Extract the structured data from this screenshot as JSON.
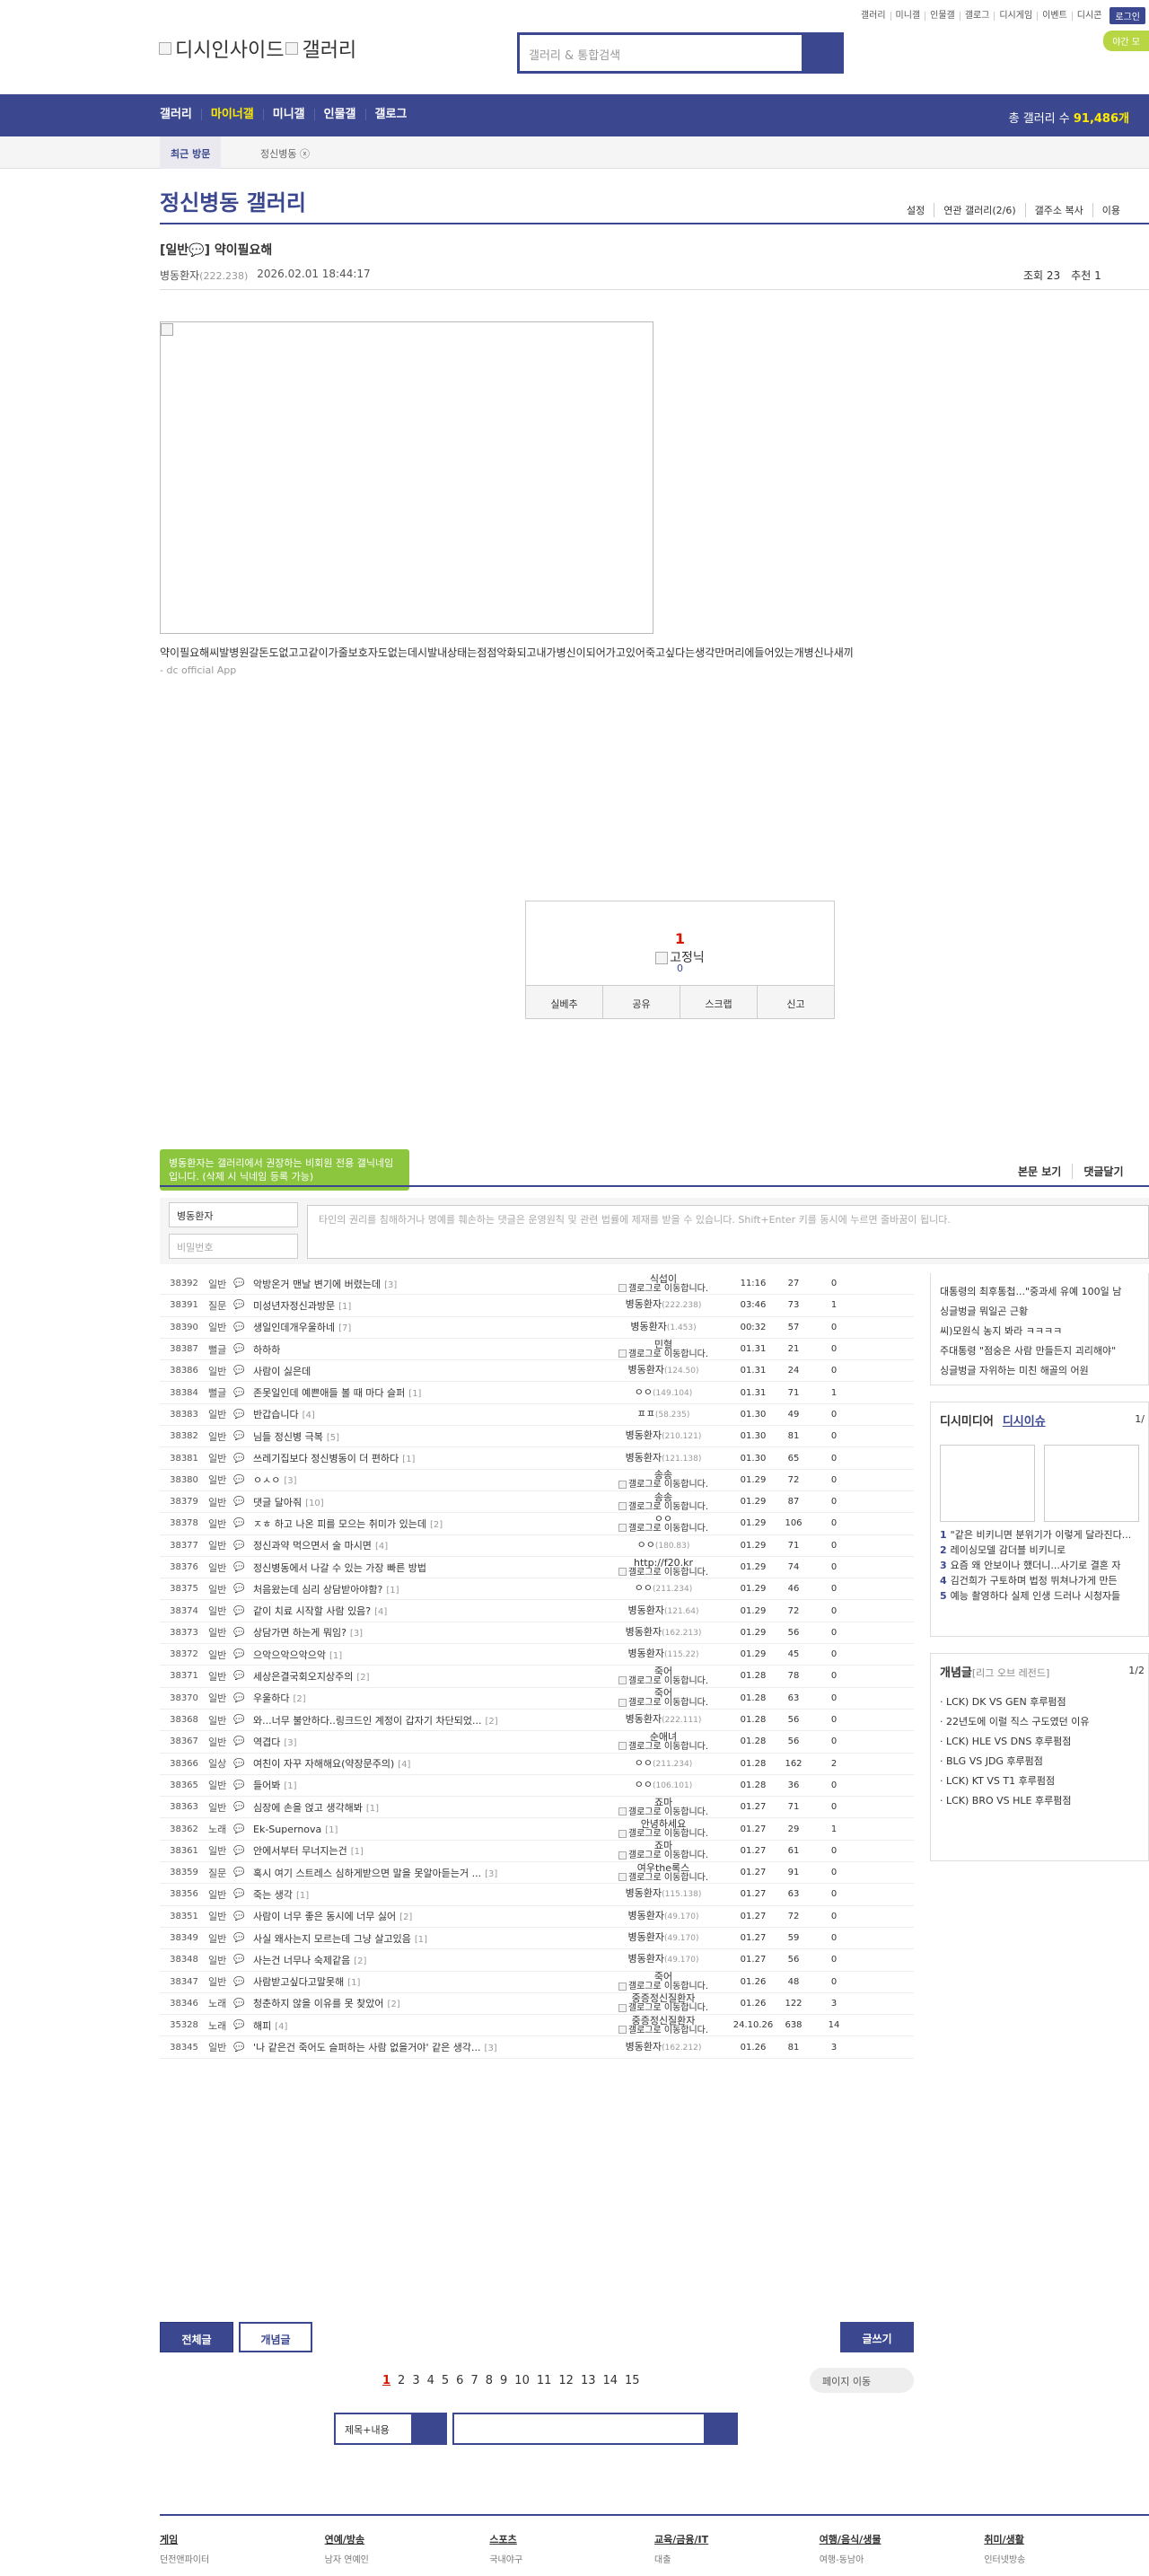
{
  "util": {
    "items": [
      "갤러리",
      "미니갤",
      "인물갤",
      "갤로그",
      "디시게임",
      "이벤트",
      "디시콘"
    ],
    "login": "로그인",
    "app": "야간 모"
  },
  "logo": {
    "alt1": "디시인사이드",
    "alt2": "갤러리"
  },
  "search": {
    "placeholder": "갤러리 & 통합검색"
  },
  "gnb": {
    "items": [
      "갤러리",
      "마이너갤",
      "미니갤",
      "인물갤",
      "갤로그"
    ],
    "count_label": "총 갤러리 수",
    "count_value": "91,486개"
  },
  "recent": {
    "tab": "최근 방문",
    "item": "정신병동"
  },
  "gallery": {
    "title": "정신병동 갤러리",
    "menu": [
      "설정",
      "연관 갤러리(2/6)",
      "갤주소 복사",
      "이용"
    ]
  },
  "post": {
    "title": "[일반💬] 약이필요해",
    "writer": "병동환자",
    "ip": "(222.238)",
    "date": "2026.02.01 18:44:17",
    "views": "조회 23",
    "recommends": "추천 1",
    "body": "약이필요해씨발병원갈돈도없고고같이가줄보호자도없는데시발내상태는점점악화되고내가병신이되어가고있어죽고싶다는생각만머리에들어있는개병신나새끼",
    "body_display": "약이필요해씨발병원갈돈도없고고같이가줄보호자도없는데시발내상태는점점악화되고내가병신이되어가고있어죽고싶다는생각만머리에들어있는개병신나새끼",
    "sub": "- dc official App"
  },
  "vote": {
    "count": "1",
    "image_alt": "고정닉",
    "fixed_count": "0",
    "buttons": [
      "실베추",
      "공유",
      "스크랩",
      "신고"
    ]
  },
  "comment": {
    "tooltip": "병동환자는 갤러리에서 권장하는 비회원 전용 갤닉네임입니다. (삭제 시 닉네임 등록 가능)",
    "links": [
      "본문 보기",
      "댓글달기"
    ],
    "name_value": "병동환자",
    "pw_placeholder": "비밀번호",
    "area_placeholder": "타인의 권리를 침해하거나 명예를 훼손하는 댓글은 운영원칙 및 관련 법률에 제재를 받을 수 있습니다. Shift+Enter 키를 동시에 누르면 줄바꿈이 됩니다."
  },
  "posts": [
    {
      "no": "38392",
      "sub": "일반",
      "title": "악방온거 맨날 변기에 버렸는데",
      "rc": "[3]",
      "writer": "식섭이",
      "gal": "갤로그로 이동합니다.",
      "date": "11:16",
      "view": "27",
      "rec": "0"
    },
    {
      "no": "38391",
      "sub": "질문",
      "title": "미성년자정신과방문",
      "rc": "[1]",
      "writer": "병동환자",
      "ip": "(222.238)",
      "date": "03:46",
      "view": "73",
      "rec": "1"
    },
    {
      "no": "38390",
      "sub": "일반",
      "title": "생일인데개우울하네",
      "rc": "[7]",
      "writer": "병동환자",
      "ip": "(1.453)",
      "date": "00:32",
      "view": "57",
      "rec": "0"
    },
    {
      "no": "38387",
      "sub": "뻘글",
      "title": "하하하",
      "rc": "",
      "writer": "민혈",
      "gal": "갤로그로 이동합니다.",
      "date": "01.31",
      "view": "21",
      "rec": "0"
    },
    {
      "no": "38386",
      "sub": "일반",
      "title": "사람이 싫은데",
      "rc": "",
      "writer": "병동환자",
      "ip": "(124.50)",
      "date": "01.31",
      "view": "24",
      "rec": "0"
    },
    {
      "no": "38384",
      "sub": "뻘글",
      "title": "존못일인데 예쁜애들 볼 때 마다 슬퍼",
      "rc": "[1]",
      "writer": "ㅇㅇ",
      "ip": "(149.104)",
      "date": "01.31",
      "view": "71",
      "rec": "1"
    },
    {
      "no": "38383",
      "sub": "일반",
      "title": "반갑습니다",
      "rc": "[4]",
      "writer": "ㅍㅍ",
      "ip": "(58.235)",
      "date": "01.30",
      "view": "49",
      "rec": "0"
    },
    {
      "no": "38382",
      "sub": "일반",
      "title": "님들 정신병 극복",
      "rc": "[5]",
      "writer": "병동환자",
      "ip": "(210.121)",
      "date": "01.30",
      "view": "81",
      "rec": "0"
    },
    {
      "no": "38381",
      "sub": "일반",
      "title": "쓰레기집보다 정신병동이 더 편하다",
      "rc": "[1]",
      "writer": "병동환자",
      "ip": "(121.138)",
      "date": "01.30",
      "view": "65",
      "rec": "0"
    },
    {
      "no": "38380",
      "sub": "일반",
      "title": "ㅇㅅㅇ",
      "rc": "[3]",
      "writer": "송송",
      "gal": "갤로그로 이동합니다.",
      "date": "01.29",
      "view": "72",
      "rec": "0"
    },
    {
      "no": "38379",
      "sub": "일반",
      "title": "댓글 달아줘",
      "rc": "[10]",
      "writer": "송송",
      "gal": "갤로그로 이동합니다.",
      "date": "01.29",
      "view": "87",
      "rec": "0"
    },
    {
      "no": "38378",
      "sub": "일반",
      "title": "ㅈㅎ 하고 나온 피를 모으는 취미가 있는데",
      "rc": "[2]",
      "writer": "ㅇㅇ",
      "gal": "갤로그로 이동합니다.",
      "date": "01.29",
      "view": "106",
      "rec": "0"
    },
    {
      "no": "38377",
      "sub": "일반",
      "title": "정신과약 먹으면서 술 마시면",
      "rc": "[4]",
      "writer": "ㅇㅇ",
      "ip": "(180.83)",
      "date": "01.29",
      "view": "71",
      "rec": "0"
    },
    {
      "no": "38376",
      "sub": "일반",
      "title": "정신병동에서 나갈 수 있는 가장 빠른 방법",
      "rc": "",
      "writer": "http://f20.kr",
      "gal": "갤로그로 이동합니다.",
      "date": "01.29",
      "view": "74",
      "rec": "0"
    },
    {
      "no": "38375",
      "sub": "일반",
      "title": "처음왔는데 심리 상담받아야함?",
      "rc": "[1]",
      "writer": "ㅇㅇ",
      "ip": "(211.234)",
      "date": "01.29",
      "view": "46",
      "rec": "0"
    },
    {
      "no": "38374",
      "sub": "일반",
      "title": "같이 치료 시작할 사람 있음?",
      "rc": "[4]",
      "writer": "병동환자",
      "ip": "(121.64)",
      "date": "01.29",
      "view": "72",
      "rec": "0"
    },
    {
      "no": "38373",
      "sub": "일반",
      "title": "상담가면 하는게 뭐임?",
      "rc": "[3]",
      "writer": "병동환자",
      "ip": "(162.213)",
      "date": "01.29",
      "view": "56",
      "rec": "0"
    },
    {
      "no": "38372",
      "sub": "일반",
      "title": "으악으악으악으악",
      "rc": "[1]",
      "writer": "병동환자",
      "ip": "(115.22)",
      "date": "01.29",
      "view": "45",
      "rec": "0"
    },
    {
      "no": "38371",
      "sub": "일반",
      "title": "세상은결국회오지상주의",
      "rc": "[2]",
      "writer": "죽어",
      "gal": "갤로그로 이동합니다.",
      "date": "01.28",
      "view": "78",
      "rec": "0"
    },
    {
      "no": "38370",
      "sub": "일반",
      "title": "우울하다",
      "rc": "[2]",
      "writer": "죽어",
      "gal": "갤로그로 이동합니다.",
      "date": "01.28",
      "view": "63",
      "rec": "0"
    },
    {
      "no": "38368",
      "sub": "일반",
      "title": "와...너무 불안하다..링크드인 계정이 갑자기 차단되었...",
      "rc": "[2]",
      "writer": "병동환자",
      "ip": "(222.111)",
      "date": "01.28",
      "view": "56",
      "rec": "0"
    },
    {
      "no": "38367",
      "sub": "일반",
      "title": "역겹다",
      "rc": "[3]",
      "writer": "순애녀",
      "gal": "갤로그로 이동합니다.",
      "date": "01.28",
      "view": "56",
      "rec": "0"
    },
    {
      "no": "38366",
      "sub": "일상",
      "title": "여친이 자꾸 자해해요(약장문주의)",
      "rc": "[4]",
      "writer": "ㅇㅇ",
      "ip": "(211.234)",
      "date": "01.28",
      "view": "162",
      "rec": "2"
    },
    {
      "no": "38365",
      "sub": "일반",
      "title": "들어봐",
      "rc": "[1]",
      "writer": "ㅇㅇ",
      "ip": "(106.101)",
      "date": "01.28",
      "view": "36",
      "rec": "0"
    },
    {
      "no": "38363",
      "sub": "일반",
      "title": "심장에 손을 얹고 생각해봐",
      "rc": "[1]",
      "writer": "죠마",
      "gal": "갤로그로 이동합니다.",
      "date": "01.27",
      "view": "71",
      "rec": "0"
    },
    {
      "no": "38362",
      "sub": "노래",
      "title": "Ek-Supernova",
      "rc": "[1]",
      "writer": "안녕하세요",
      "gal": "갤로그로 이동합니다.",
      "date": "01.27",
      "view": "29",
      "rec": "1"
    },
    {
      "no": "38361",
      "sub": "일반",
      "title": "안에서부터 무너지는건",
      "rc": "[1]",
      "writer": "죠마",
      "gal": "갤로그로 이동합니다.",
      "date": "01.27",
      "view": "61",
      "rec": "0"
    },
    {
      "no": "38359",
      "sub": "질문",
      "title": "혹시 여기 스트레스 심하게받으면 말을 못알아듣는거 ...",
      "rc": "[3]",
      "writer": "여우the록스",
      "gal": "갤로그로 이동합니다.",
      "date": "01.27",
      "view": "91",
      "rec": "0"
    },
    {
      "no": "38356",
      "sub": "일반",
      "title": "죽는 생각",
      "rc": "[1]",
      "writer": "병동환자",
      "ip": "(115.138)",
      "date": "01.27",
      "view": "63",
      "rec": "0"
    },
    {
      "no": "38351",
      "sub": "일반",
      "title": "사람이 너무 좋은 동시에 너무 싫어",
      "rc": "[2]",
      "writer": "병동환자",
      "ip": "(49.170)",
      "date": "01.27",
      "view": "72",
      "rec": "0"
    },
    {
      "no": "38349",
      "sub": "일반",
      "title": "사실 왜사는지 모르는데 그냥 살고있음",
      "rc": "[1]",
      "writer": "병동환자",
      "ip": "(49.170)",
      "date": "01.27",
      "view": "59",
      "rec": "0"
    },
    {
      "no": "38348",
      "sub": "일반",
      "title": "사는건 너무나 숙제같음",
      "rc": "[2]",
      "writer": "병동환자",
      "ip": "(49.170)",
      "date": "01.27",
      "view": "56",
      "rec": "0"
    },
    {
      "no": "38347",
      "sub": "일반",
      "title": "사람받고싶다고말못해",
      "rc": "[1]",
      "writer": "죽어",
      "gal": "갤로그로 이동합니다.",
      "date": "01.26",
      "view": "48",
      "rec": "0"
    },
    {
      "no": "38346",
      "sub": "노래",
      "title": "청춘하지 않을 이유를 못 찾았어",
      "rc": "[2]",
      "writer": "중증정신질환자",
      "gal": "갤로그로 이동합니다.",
      "date": "01.26",
      "view": "122",
      "rec": "3"
    },
    {
      "no": "35328",
      "sub": "노래",
      "title": "해피",
      "rc": "[4]",
      "writer": "중증정신질환자",
      "gal": "갤로그로 이동합니다.",
      "date": "24.10.26",
      "view": "638",
      "rec": "14"
    },
    {
      "no": "38345",
      "sub": "일반",
      "title": "'나 같은건 죽어도 슬퍼하는 사람 없을거야' 같은 생각...",
      "rc": "[3]",
      "writer": "병동환자",
      "ip": "(162.212)",
      "date": "01.26",
      "view": "81",
      "rec": "3"
    }
  ],
  "sidebar": {
    "news": [
      "대통령의 최후통첩...\"중과세 유예 100일 남",
      "싱글벙글 뭐일곤 근황",
      "씨)모원식 농지 봐라 ㅋㅋㅋㅋ",
      "주대통령 \"점숭은 사람 만들든지 괴리해야\"",
      "싱글벙글 자위하는 미친 해골의 어원"
    ],
    "media_tabs": [
      "디시미디어",
      "디시이슈"
    ],
    "media_page": "1/",
    "media_items": [
      {
        "n": "1",
        "t": "\"같은 비키니면 분위기가 이렇게 달라진다..."
      },
      {
        "n": "2",
        "t": "레이싱모델 감더블 비키니로"
      },
      {
        "n": "3",
        "t": "요즘 왜 안보이나 했더니...사기로 결혼 자"
      },
      {
        "n": "4",
        "t": "김건희가 구토하며 법정 뛰쳐나가게 만든"
      },
      {
        "n": "5",
        "t": "예능 촬영하다 실제 인생 드러나 시청자들"
      }
    ],
    "concept_title": "개념글",
    "concept_sub": "[리그 오브 레전드]",
    "concept_page": "1/2",
    "concept_items": [
      "LCK) DK VS GEN 후루펌점",
      "22년도에 이럴 직스 구도였던 이유",
      "LCK) HLE VS DNS 후루펌점",
      "BLG VS JDG 후루펌점",
      "LCK) KT VS T1 후루펌점",
      "LCK) BRO VS HLE 후루펌점"
    ]
  },
  "buttons": {
    "all": "전체글",
    "concept": "개념글",
    "write": "글쓰기"
  },
  "paging": {
    "pages": [
      "1",
      "2",
      "3",
      "4",
      "5",
      "6",
      "7",
      "8",
      "9",
      "10",
      "11",
      "12",
      "13",
      "14",
      "15"
    ],
    "jump": "페이지 이동"
  },
  "bottom_search": {
    "select": "제목+내용"
  },
  "footer": [
    {
      "h": "게임",
      "s": "던전앤파이터"
    },
    {
      "h": "연예/방송",
      "s": "남자 연예인"
    },
    {
      "h": "스포츠",
      "s": "국내야구"
    },
    {
      "h": "교육/금융/IT",
      "s": "대출"
    },
    {
      "h": "여행/음식/생물",
      "s": "여행-동남아"
    },
    {
      "h": "취미/생활",
      "s": "인터넷방송"
    }
  ]
}
